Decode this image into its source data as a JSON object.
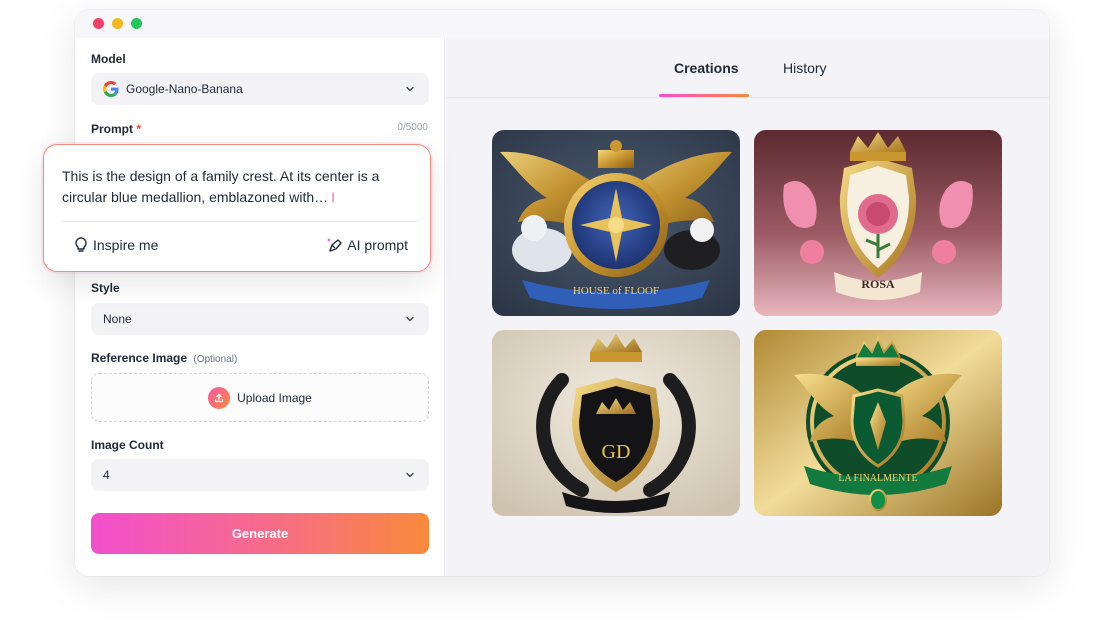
{
  "window": {
    "controls": [
      "close",
      "minimize",
      "maximize"
    ]
  },
  "form": {
    "model_label": "Model",
    "model_value": "Google-Nano-Banana",
    "prompt_label": "Prompt",
    "prompt_required": "*",
    "prompt_counter": "0/5000",
    "prompt_text": "This is the design of a family crest. At its center is a circular blue medallion, emblazoned with…",
    "inspire_label": "Inspire me",
    "ai_prompt_label": "AI prompt",
    "style_label": "Style",
    "style_value": "None",
    "reference_label": "Reference Image",
    "reference_optional": "(Optional)",
    "upload_label": "Upload Image",
    "count_label": "Image Count",
    "count_value": "4",
    "generate_label": "Generate"
  },
  "tabs": [
    {
      "label": "Creations",
      "active": true
    },
    {
      "label": "History",
      "active": false
    }
  ],
  "creations": [
    {
      "caption": "HOUSE of FLOOF"
    },
    {
      "caption": "ROSA"
    },
    {
      "caption": "GD"
    },
    {
      "caption": "LA FINALMENTE"
    }
  ],
  "colors": {
    "accent_start": "#f24fce",
    "accent_end": "#f98a3a",
    "required": "#ef4444"
  }
}
